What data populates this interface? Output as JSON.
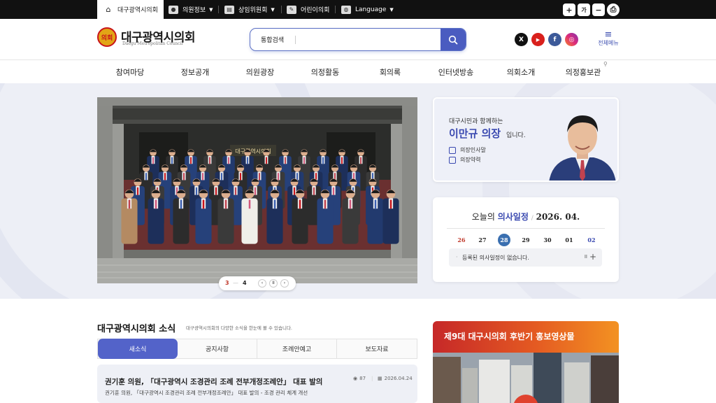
{
  "topbar": {
    "home": "대구광역시의회",
    "items": [
      "의원정보",
      "상임위원회",
      "어린이의회",
      "Language"
    ],
    "zoom_in": "+",
    "font": "가",
    "zoom_out": "−",
    "print": "⎙"
  },
  "header": {
    "logo_mark": "의회",
    "logo_title": "대구광역시의회",
    "logo_sub": "Daegu Metropolitan Council",
    "search_label": "통합검색",
    "search_value": "",
    "social": [
      "X",
      "▶",
      "f",
      "◎"
    ],
    "all_menu": "전체메뉴"
  },
  "nav": [
    "참여마당",
    "정보공개",
    "의원광장",
    "의정활동",
    "회의록",
    "인터넷방송",
    "의회소개",
    "의정홍보관"
  ],
  "hero": {
    "pager_current": "3",
    "pager_total": "4",
    "building_sign": "대구광역시의회",
    "chair_pre": "대구시민과 함께하는",
    "chair_name": "이만규 의장",
    "chair_suffix": "입니다.",
    "chair_links": [
      "의장인사말",
      "의장약력"
    ]
  },
  "schedule": {
    "title_pre": "오늘의",
    "title_hl": "의사일정",
    "date": "2026. 04.",
    "days": [
      "26",
      "27",
      "28",
      "29",
      "30",
      "01",
      "02"
    ],
    "today_index": 2,
    "empty_msg": "등록된 의사일정이 없습니다.",
    "pause": "II",
    "more": "+"
  },
  "news": {
    "title": "대구광역시의회 소식",
    "desc": "대구광역시의회의 다양한 소식을 한눈에 볼 수 있습니다.",
    "tabs": [
      "새소식",
      "공지사항",
      "조례안예고",
      "보도자료"
    ],
    "item_title": "권기훈 의원, 「대구광역시 조경관리 조례 전부개정조례안」 대표 발의",
    "item_views": "87",
    "item_date": "2026.04.24",
    "item_sub": "권기훈 의원, 「대구광역시 조경관리 조례 전부개정조례안」 대표 발의 - 조경 관리 체계 개선"
  },
  "promo": {
    "title": "제9대 대구시의회 후반기 홍보영상물"
  },
  "colors": {
    "accent": "#4a5cc0",
    "brand_red": "#c9141a",
    "topbar": "#111111"
  }
}
